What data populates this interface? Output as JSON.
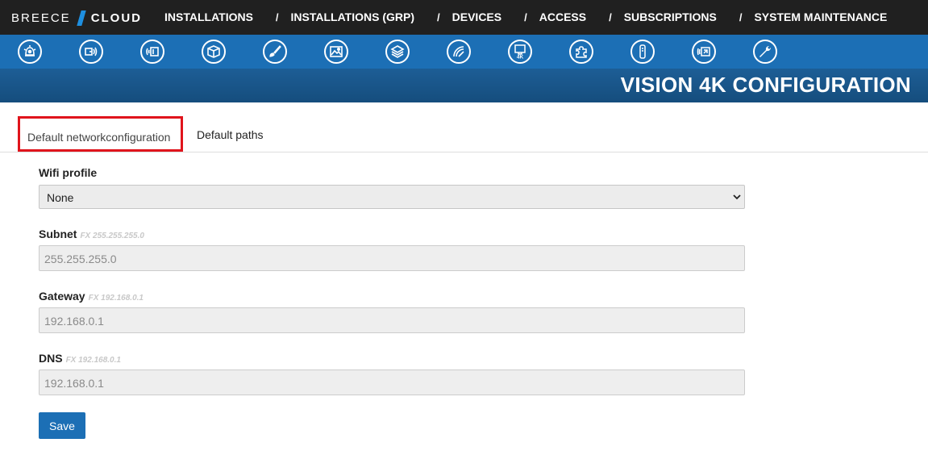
{
  "brand": {
    "part1": "BREECE",
    "part2": "CLOUD"
  },
  "nav": {
    "items": [
      {
        "label": "INSTALLATIONS"
      },
      {
        "label": "INSTALLATIONS (GRP)"
      },
      {
        "label": "DEVICES"
      },
      {
        "label": "ACCESS"
      },
      {
        "label": "SUBSCRIPTIONS"
      },
      {
        "label": "SYSTEM MAINTENANCE"
      }
    ],
    "separator": "/"
  },
  "icons": [
    "alarm-bell-icon",
    "sensor-icon",
    "transmitter-icon",
    "package-icon",
    "paint-brush-icon",
    "image-icon",
    "layers-icon",
    "signal-gauge-icon",
    "vision-4k-icon",
    "puzzle-icon",
    "remote-control-icon",
    "display-input-icon",
    "wrench-icon"
  ],
  "page": {
    "title": "VISION 4K CONFIGURATION"
  },
  "tabs": {
    "network": "Default networkconfiguration",
    "paths": "Default paths"
  },
  "form": {
    "wifi": {
      "label": "Wifi profile",
      "value": "None"
    },
    "subnet": {
      "label": "Subnet",
      "hint": "FX 255.255.255.0",
      "value": "255.255.255.0"
    },
    "gateway": {
      "label": "Gateway",
      "hint": "FX 192.168.0.1",
      "value": "192.168.0.1"
    },
    "dns": {
      "label": "DNS",
      "hint": "FX 192.168.0.1",
      "value": "192.168.0.1"
    },
    "save_label": "Save"
  },
  "colors": {
    "topbar": "#202020",
    "iconbar": "#1c6fb5",
    "titlebar": "#1a578b",
    "brand_accent": "#1e8fe0",
    "active_tab_border": "#e0141c",
    "button": "#1c6fb5"
  }
}
